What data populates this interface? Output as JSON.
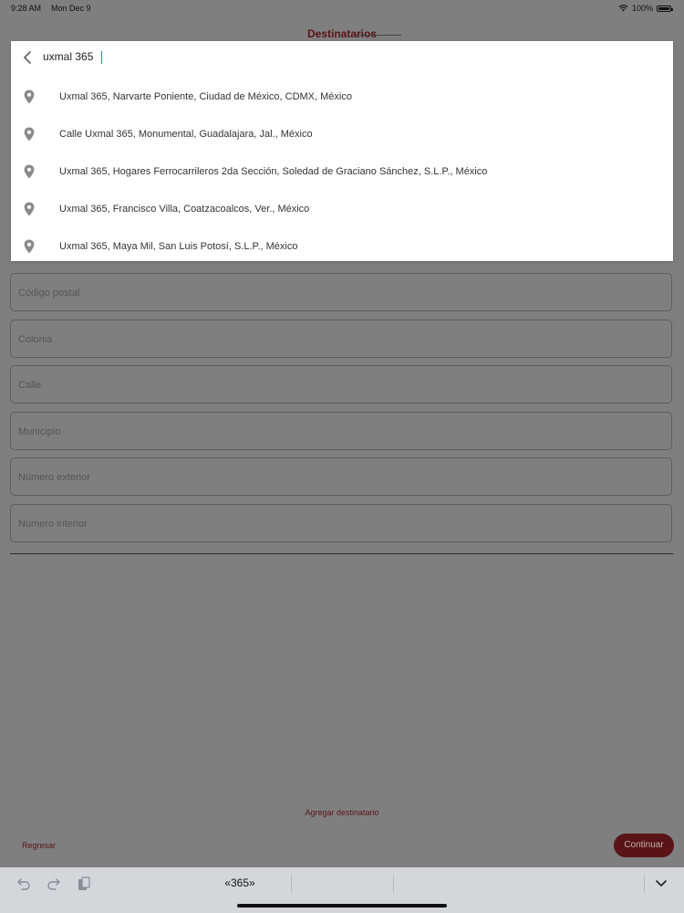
{
  "status_bar": {
    "time": "9:28 AM",
    "date": "Mon Dec 9",
    "battery": "100%"
  },
  "header": {
    "title": "Destinatarios"
  },
  "search": {
    "value": "uxmal 365"
  },
  "suggestions": [
    {
      "text": "Uxmal 365, Narvarte Poniente, Ciudad de México, CDMX, México"
    },
    {
      "text": "Calle Uxmal 365, Monumental, Guadalajara, Jal., México"
    },
    {
      "text": "Uxmal 365, Hogares Ferrocarrileros 2da Sección, Soledad de Graciano Sánchez, S.L.P., México"
    },
    {
      "text": "Uxmal 365, Francisco Villa, Coatzacoalcos, Ver., México"
    },
    {
      "text": "Uxmal 365, Maya Mil, San Luis Potosí, S.L.P., México"
    }
  ],
  "form": {
    "fields": [
      {
        "placeholder": "Código postal"
      },
      {
        "placeholder": "Colonia"
      },
      {
        "placeholder": "Calle"
      },
      {
        "placeholder": "Municipio"
      },
      {
        "placeholder": "Número exterior"
      },
      {
        "placeholder": "Número interior"
      }
    ]
  },
  "actions": {
    "add_recipient": "Agregar destinatario",
    "back": "Regresar",
    "continue": "Continuar"
  },
  "keyboard": {
    "suggestion": "«365»"
  },
  "colors": {
    "brand": "#5a1316",
    "overlay": "#7f7f7f",
    "caret": "#2d7ff9"
  },
  "icons": [
    "chevron-back-icon",
    "location-pin-icon",
    "undo-icon",
    "redo-icon",
    "paste-icon",
    "keyboard-dismiss-icon",
    "wifi-icon",
    "battery-icon"
  ]
}
